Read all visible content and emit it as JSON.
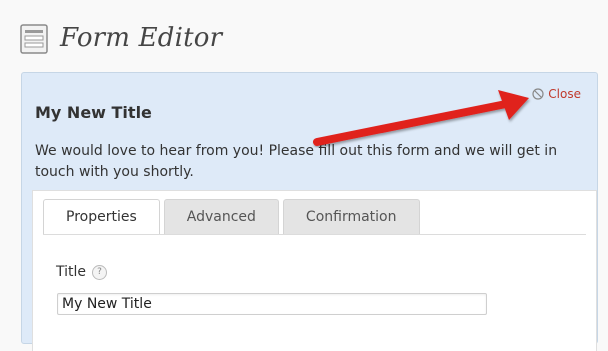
{
  "page": {
    "title": "Form Editor"
  },
  "panel": {
    "title": "My New Title",
    "close_label": "Close",
    "description": "We would love to hear from you! Please fill out this form and we will get in touch with you shortly."
  },
  "tabs": [
    {
      "label": "Properties",
      "active": true
    },
    {
      "label": "Advanced",
      "active": false
    },
    {
      "label": "Confirmation",
      "active": false
    }
  ],
  "fields": {
    "title_label": "Title",
    "help_glyph": "?",
    "title_value": "My New Title"
  },
  "colors": {
    "panel_bg": "#deeaf8",
    "close_red": "#c0392b",
    "annotation_arrow": "#e0201e"
  },
  "icons": [
    "form-editor-icon",
    "close-icon",
    "help-icon",
    "annotation-arrow"
  ]
}
